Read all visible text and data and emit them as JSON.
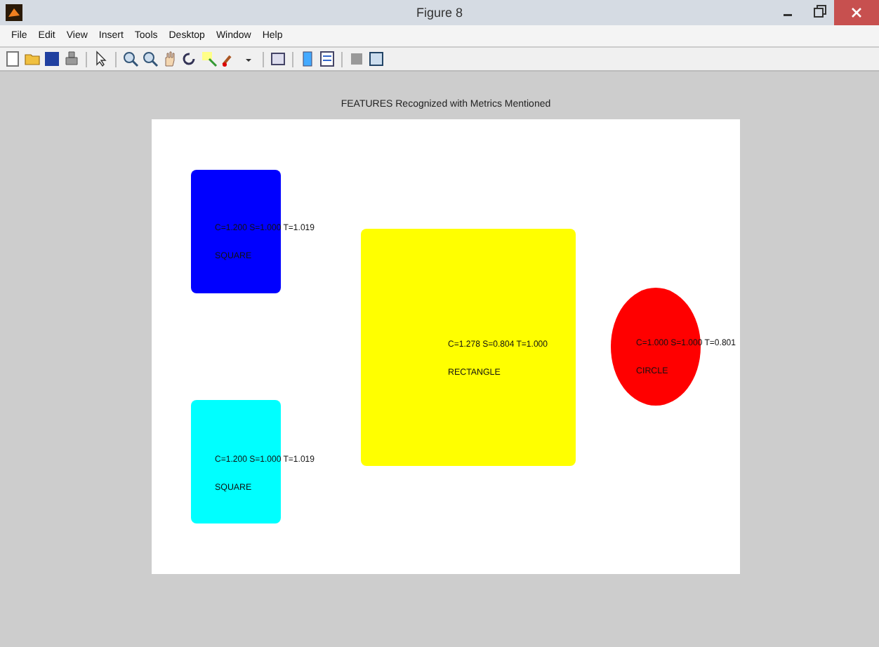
{
  "window": {
    "title": "Figure 8"
  },
  "menu": [
    "File",
    "Edit",
    "View",
    "Insert",
    "Tools",
    "Desktop",
    "Window",
    "Help"
  ],
  "figure": {
    "title": "FEATURES Recognized with Metrics Mentioned",
    "shapes": [
      {
        "kind": "rect",
        "color": "#0000ff",
        "metrics": "C=1.200 S=1.000 T=1.019",
        "label": "SQUARE"
      },
      {
        "kind": "rect",
        "color": "#00ffff",
        "metrics": "C=1.200 S=1.000 T=1.019",
        "label": "SQUARE"
      },
      {
        "kind": "rect",
        "color": "#ffff00",
        "metrics": "C=1.278 S=0.804 T=1.000",
        "label": "RECTANGLE"
      },
      {
        "kind": "ellipse",
        "color": "#ff0000",
        "metrics": "C=1.000 S=1.000 T=0.801",
        "label": "CIRCLE"
      }
    ]
  }
}
